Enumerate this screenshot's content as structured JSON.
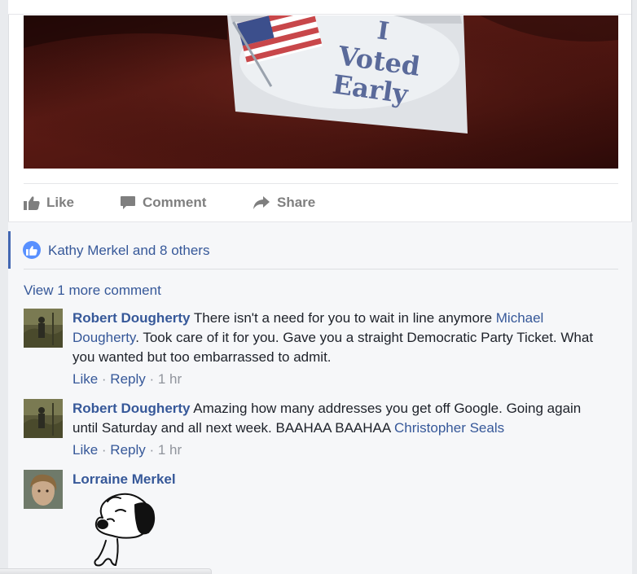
{
  "post": {
    "photo_sticker_text": [
      "I",
      "Voted",
      "Early"
    ]
  },
  "actions": {
    "like": "Like",
    "comment": "Comment",
    "share": "Share"
  },
  "likes_summary": "Kathy Merkel and 8 others",
  "view_more": "View 1 more comment",
  "comments": [
    {
      "author": "Robert Dougherty",
      "text_1": " There isn't a need for you to wait in line anymore ",
      "mention": "Michael Dougherty",
      "text_2": ". Took care of it for you. Gave you a straight Democratic Party Ticket. What you wanted but too embarrassed to admit.",
      "like": "Like",
      "reply": "Reply",
      "time": "1 hr"
    },
    {
      "author": "Robert Dougherty",
      "text_1": " Amazing how many addresses you get off Google. Going again until Saturday and all next week. BAAHAA BAAHAA ",
      "mention": "Christopher Seals",
      "text_2": "",
      "like": "Like",
      "reply": "Reply",
      "time": "1 hr"
    },
    {
      "author": "Lorraine Merkel",
      "sticker": "snoopy-sticker"
    }
  ],
  "colors": {
    "link": "#365899",
    "accent": "#4267b2",
    "meta": "#90949c",
    "action": "#7f7f7f"
  }
}
